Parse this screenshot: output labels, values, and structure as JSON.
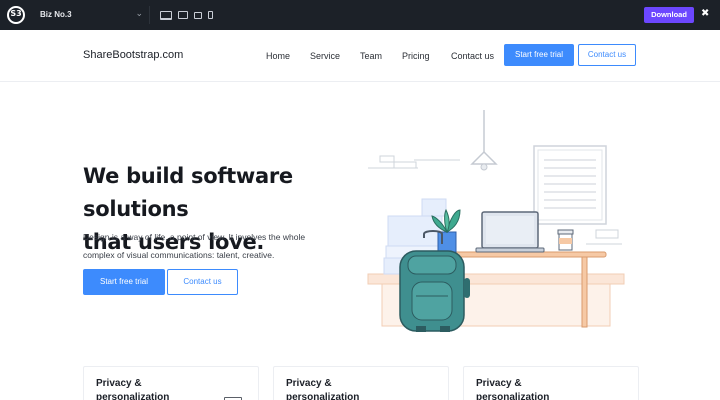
{
  "topbar": {
    "logo_text": "S3",
    "theme_name": "Biz No.3",
    "download_label": "Download",
    "close_label": "✖",
    "devices": [
      "desktop",
      "laptop",
      "tablet",
      "phone"
    ]
  },
  "nav": {
    "brand": "ShareBootstrap.com",
    "links": [
      "Home",
      "Service",
      "Team",
      "Pricing",
      "Contact us"
    ],
    "primary_button": "Start free trial",
    "outline_button": "Contact us"
  },
  "hero": {
    "title_line1": "We build software solutions",
    "title_line2": "that users love.",
    "text": "Design is a way of life, a point of view. It involves the whole complex of visual communications: talent, creative.",
    "primary_button": "Start free trial",
    "outline_button": "Contact us"
  },
  "cards": [
    {
      "title": "Privacy & personalization"
    },
    {
      "title": "Privacy & personalization"
    },
    {
      "title": "Privacy & personalization"
    }
  ],
  "colors": {
    "topbar_bg": "#1c2128",
    "download_purple": "#6c47ff",
    "accent_blue": "#3d8bfd",
    "backpack_teal": "#3f8f8f",
    "desk_peach": "#f5c9a8"
  }
}
